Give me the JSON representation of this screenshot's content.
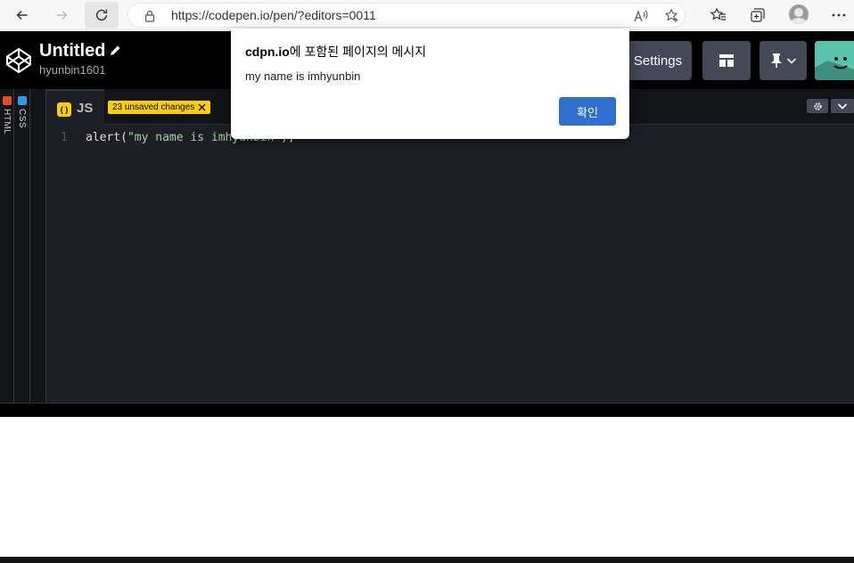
{
  "browser": {
    "url": "https://codepen.io/pen/?editors=0011"
  },
  "header": {
    "title": "Untitled",
    "user": "hyunbin1601",
    "settings_label": "Settings"
  },
  "sidebar": {
    "html_label": "HTML",
    "css_label": "CSS"
  },
  "editor": {
    "tab_label": "JS",
    "unsaved_label": "23 unsaved changes",
    "line_number": "1",
    "code_prefix": "alert(",
    "code_string": "\"my name is imhyunbin\"",
    "code_suffix": ");"
  },
  "dialog": {
    "title_host": "cdpn.io",
    "title_rest": "에 포함된 페이지의 메시지",
    "message": "my name is imhyunbin",
    "ok_label": "확인"
  },
  "colors": {
    "js_badge": "#fcd000",
    "html_badge": "#e44d26",
    "css_badge": "#2b9af3",
    "ok_button": "#2f6fd0"
  }
}
